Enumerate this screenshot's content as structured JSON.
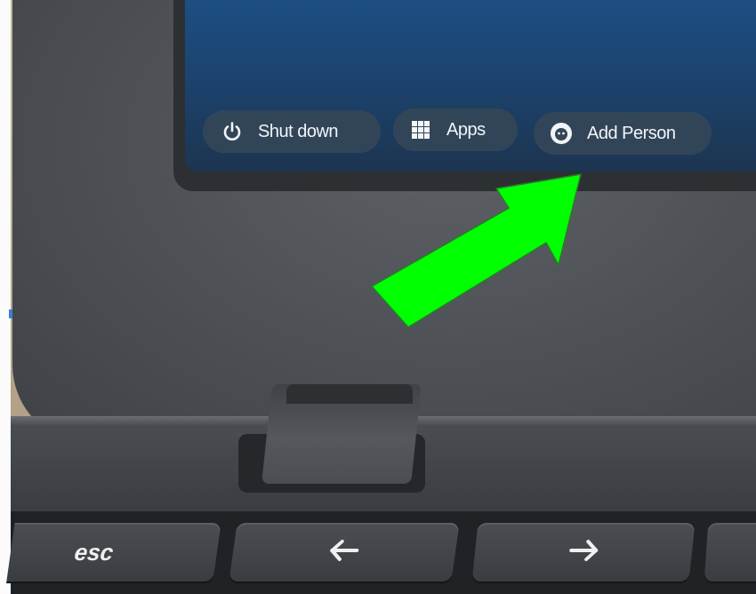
{
  "shelf": {
    "shutdown": {
      "label": "Shut down",
      "icon": "power-icon"
    },
    "apps": {
      "label": "Apps",
      "icon": "grid-icon"
    },
    "add_person": {
      "label": "Add Person",
      "icon": "person-icon"
    }
  },
  "keyboard": {
    "esc_label": "esc",
    "back_icon": "arrow-left-icon",
    "forward_icon": "arrow-right-icon"
  },
  "annotation": {
    "type": "arrow",
    "color": "#00ff00",
    "points_to": "Add Person"
  }
}
